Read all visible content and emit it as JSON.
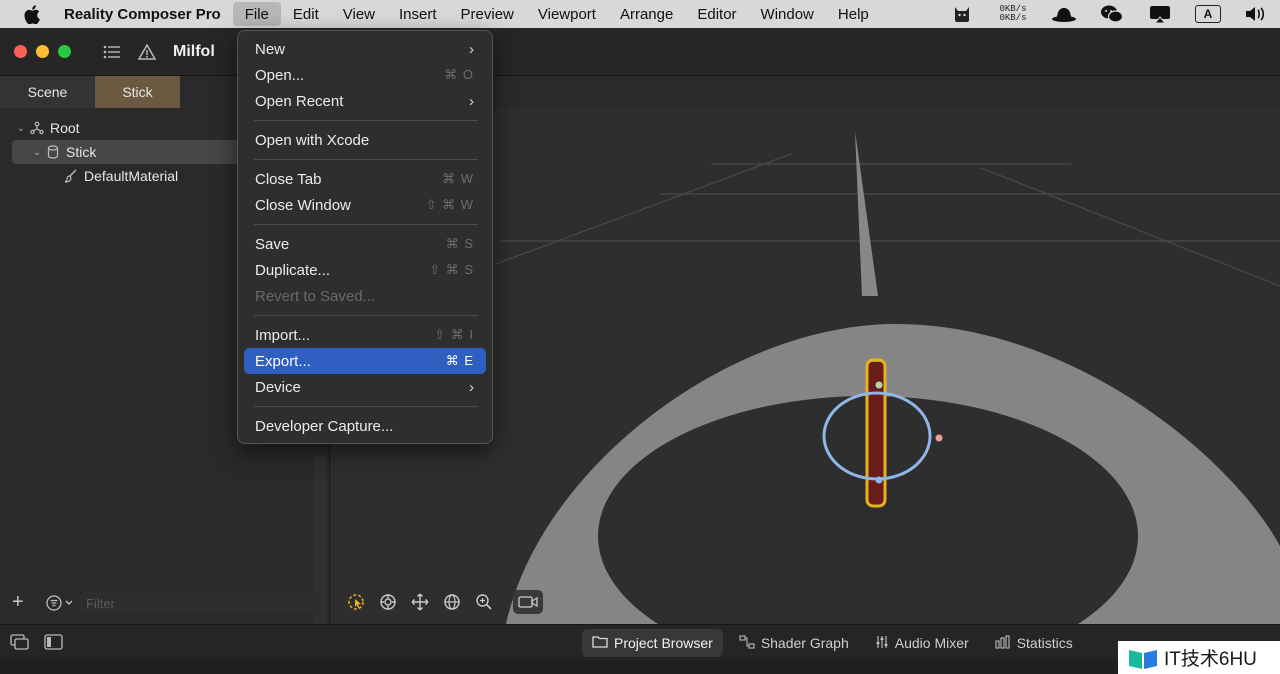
{
  "menubar": {
    "app_name": "Reality Composer Pro",
    "items": [
      "File",
      "Edit",
      "View",
      "Insert",
      "Preview",
      "Viewport",
      "Arrange",
      "Editor",
      "Window",
      "Help"
    ],
    "active_item": "File",
    "net_up": "0KB/s",
    "net_down": "0KB/s",
    "input_source": "A"
  },
  "window": {
    "title": "Milfol"
  },
  "left_panel": {
    "tabs": [
      "Scene",
      "Stick"
    ],
    "selected_tab": "Stick",
    "tree": [
      {
        "label": "Root"
      },
      {
        "label": "Stick"
      },
      {
        "label": "DefaultMaterial"
      }
    ],
    "filter_placeholder": "Filter"
  },
  "file_menu": {
    "items": [
      {
        "label": "New",
        "shortcut": "",
        "submenu": "›"
      },
      {
        "label": "Open...",
        "shortcut": "⌘ O",
        "submenu": ""
      },
      {
        "label": "Open Recent",
        "shortcut": "",
        "submenu": "›"
      },
      {
        "label": "Open with Xcode",
        "shortcut": "",
        "submenu": ""
      },
      {
        "label": "Close Tab",
        "shortcut": "⌘ W",
        "submenu": ""
      },
      {
        "label": "Close Window",
        "shortcut": "⇧ ⌘ W",
        "submenu": ""
      },
      {
        "label": "Save",
        "shortcut": "⌘ S",
        "submenu": ""
      },
      {
        "label": "Duplicate...",
        "shortcut": "⇧ ⌘ S",
        "submenu": ""
      },
      {
        "label": "Revert to Saved...",
        "shortcut": "",
        "submenu": ""
      },
      {
        "label": "Import...",
        "shortcut": "⇧ ⌘ I",
        "submenu": ""
      },
      {
        "label": "Export...",
        "shortcut": "⌘ E",
        "submenu": ""
      },
      {
        "label": "Device",
        "shortcut": "",
        "submenu": "›"
      },
      {
        "label": "Developer Capture...",
        "shortcut": "",
        "submenu": ""
      }
    ],
    "highlighted": "Export...",
    "disabled": [
      "Revert to Saved..."
    ]
  },
  "bottom_tabs": [
    "Project Browser",
    "Shader Graph",
    "Audio Mixer",
    "Statistics"
  ],
  "selected_bottom_tab": "Project Browser",
  "watermark": "IT技术6HU",
  "colors": {
    "accent": "#2f5fc0",
    "selected_tab": "#6b5a41",
    "selection_outline": "#e8b21c",
    "gizmo_ring": "#8fb6e8"
  }
}
